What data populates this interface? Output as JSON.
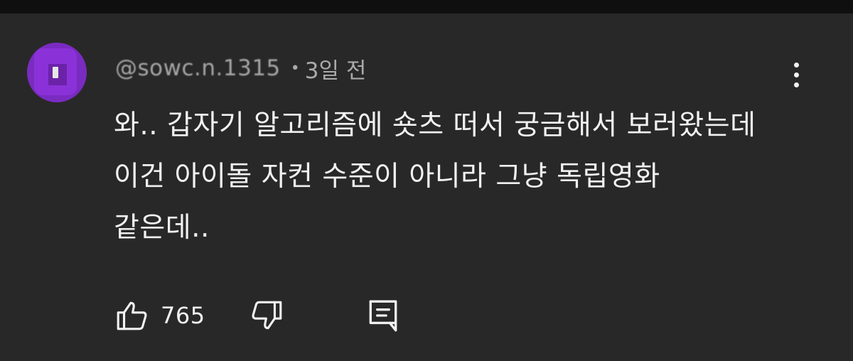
{
  "comment": {
    "author": "@sowc.n.1315",
    "time": "3일 전",
    "separator": "•",
    "text_lines": [
      "와.. 갑자기 알고리즘에 숏츠 떠서 궁금해서 보러왔는데",
      "이건 아이돌 자컨 수준이 아니라 그냥 독립영화",
      "같은데.."
    ],
    "like_count": "765",
    "icons": {
      "more": "more-vert-icon",
      "like": "thumbs-up-icon",
      "dislike": "thumbs-down-icon",
      "reply": "reply-icon"
    },
    "colors": {
      "background": "#282828",
      "top_bar": "#0f0f0f",
      "text": "#f1f1f1",
      "meta_text": "#aaaaaa",
      "avatar": "#7a2bc0"
    }
  }
}
